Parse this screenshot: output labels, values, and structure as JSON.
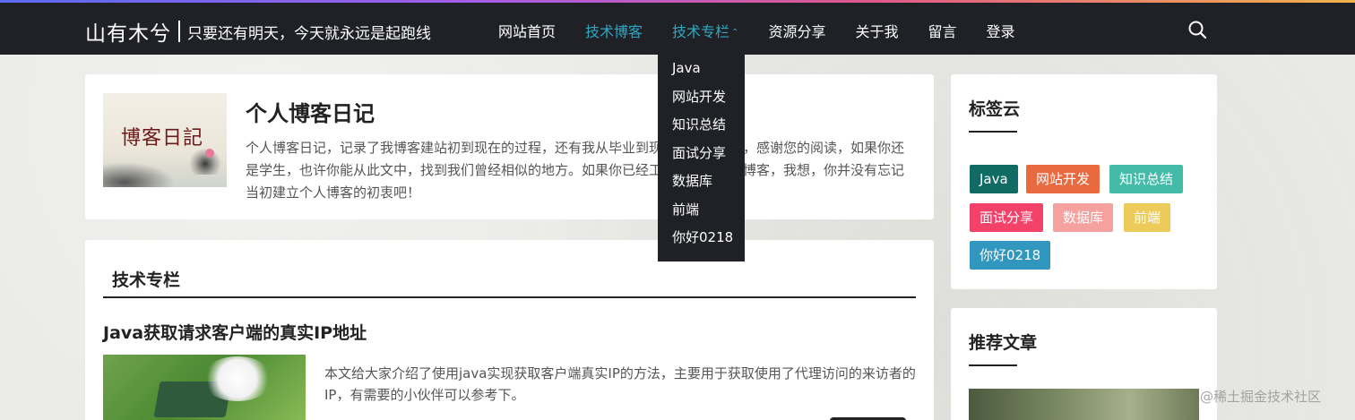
{
  "navbar": {
    "brand_name": "山有木兮",
    "motto": "只要还有明天，今天就永远是起跑线",
    "items": [
      {
        "label": "网站首页"
      },
      {
        "label": "技术博客"
      },
      {
        "label": "技术专栏",
        "caret": "⌃"
      },
      {
        "label": "资源分享"
      },
      {
        "label": "关于我"
      },
      {
        "label": "留言"
      },
      {
        "label": "登录"
      }
    ],
    "search_icon": "search-icon",
    "active_color": "#2ea8c2"
  },
  "dropdown": {
    "items": [
      "Java",
      "网站开发",
      "知识总结",
      "面试分享",
      "数据库",
      "前端",
      "你好0218"
    ]
  },
  "intro": {
    "thumb_title": "博客日記",
    "title": "个人博客日记",
    "text": "个人博客日记，记录了我博客建站初到现在的过程，还有我从毕业到现在的工作状态，感谢您的阅读，如果你还是学生，也许你能从此文中，找到我们曾经相似的地方。如果你已经工作，有自己的博客，我想，你并没有忘记当初建立个人博客的初衷吧！"
  },
  "column": {
    "title": "技术专栏",
    "article": {
      "title": "Java获取请求客户端的真实IP地址",
      "summary": "本文给大家介绍了使用java实现获取客户端真实IP的方法，主要用于获取使用了代理访问的来访者的IP，有需要的小伙伴可以参考下。"
    }
  },
  "sidebar": {
    "tags_title": "标签云",
    "tags": [
      {
        "label": "Java",
        "color": "#0f6b63"
      },
      {
        "label": "网站开发",
        "color": "#ea6a3f"
      },
      {
        "label": "知识总结",
        "color": "#44bba8"
      },
      {
        "label": "面试分享",
        "color": "#f2426a"
      },
      {
        "label": "数据库",
        "color": "#f6a0a0"
      },
      {
        "label": "前端",
        "color": "#eccb5a"
      },
      {
        "label": "你好0218",
        "color": "#3197bf"
      }
    ],
    "recommend_title": "推荐文章"
  },
  "watermark": "@稀土掘金技术社区"
}
